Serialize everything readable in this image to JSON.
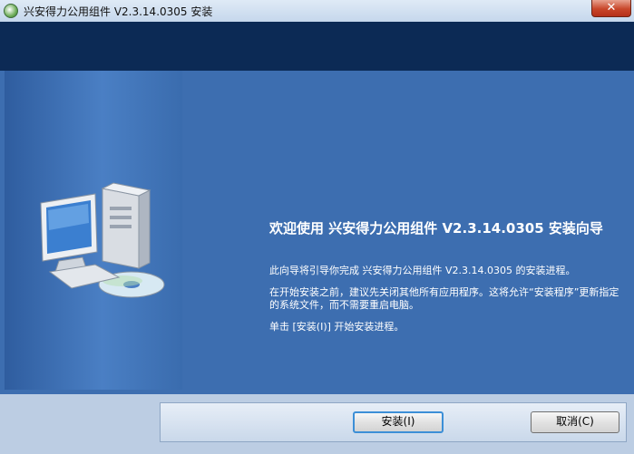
{
  "window": {
    "title": "兴安得力公用组件 V2.3.14.0305 安装",
    "close_glyph": "✕"
  },
  "content": {
    "heading": "欢迎使用 兴安得力公用组件 V2.3.14.0305 安装向导",
    "paragraph1": "此向导将引导你完成 兴安得力公用组件 V2.3.14.0305 的安装进程。",
    "paragraph2": "在开始安装之前，建议先关闭其他所有应用程序。这将允许“安装程序”更新指定的系统文件，而不需要重启电脑。",
    "paragraph3": "单击 [安装(I)] 开始安装进程。"
  },
  "buttons": {
    "install_label": "安装(I)",
    "cancel_label": "取消(C)"
  }
}
